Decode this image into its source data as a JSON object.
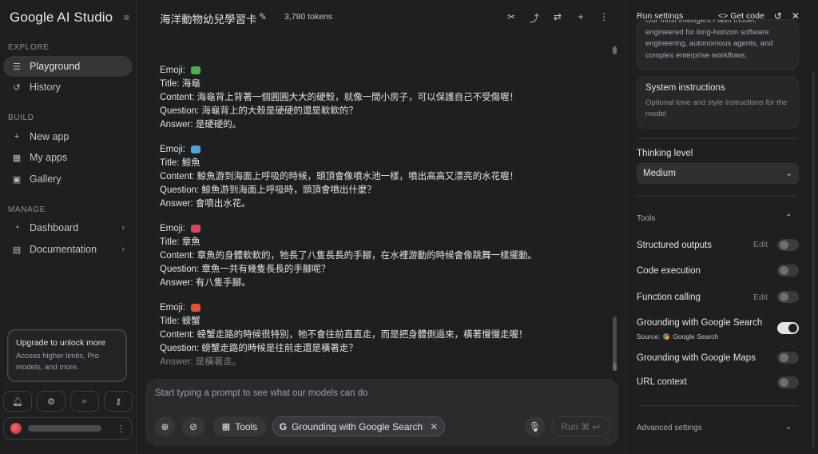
{
  "sidebar": {
    "logo": "Google AI Studio",
    "collapse_icon": "sidebar-collapse-icon",
    "explore_label": "EXPLORE",
    "playground": "Playground",
    "history": "History",
    "build_label": "BUILD",
    "new_app": "New app",
    "my_apps": "My apps",
    "gallery": "Gallery",
    "manage_label": "MANAGE",
    "dashboard": "Dashboard",
    "documentation": "Documentation",
    "upgrade_title": "Upgrade to unlock more",
    "upgrade_desc": "Access higher limits, Pro models, and more."
  },
  "topbar": {
    "title": "海洋動物幼兒學習卡",
    "tokens": "3,780 tokens"
  },
  "chat": {
    "cards": [
      {
        "emoji": "Emoji: ",
        "title": "Title: 海龜",
        "content": "Content: 海龜背上背著一個圓圓大大的硬殼，就像一間小房子，可以保護自己不受傷喔！",
        "question": "Question: 海龜背上的大殼是硬硬的還是軟軟的？",
        "answer": "Answer: 是硬硬的。"
      },
      {
        "emoji": "Emoji: ",
        "title": "Title: 鯨魚",
        "content": "Content: 鯨魚游到海面上呼吸的時候，頭頂會像噴水池一樣，噴出高高又漂亮的水花喔！",
        "question": "Question: 鯨魚游到海面上呼吸時，頭頂會噴出什麼？",
        "answer": "Answer: 會噴出水花。"
      },
      {
        "emoji": "Emoji: ",
        "title": "Title: 章魚",
        "content": "Content: 章魚的身體軟軟的，牠長了八隻長長的手腳，在水裡游動的時候會像跳舞一樣擺動。",
        "question": "Question: 章魚一共有幾隻長長的手腳呢？",
        "answer": "Answer: 有八隻手腳。"
      },
      {
        "emoji": "Emoji: ",
        "title": "Title: 螃蟹",
        "content": "Content: 螃蟹走路的時候很特別，牠不會往前直直走，而是把身體側過來，橫著慢慢走喔！",
        "question": "Question: 螃蟹走路的時候是往前走還是橫著走？",
        "answer": "Answer: 是橫著走。"
      }
    ]
  },
  "composer": {
    "placeholder": "Start typing a prompt to see what our models can do",
    "tools_label": "Tools",
    "grounding_chip": "Grounding with Google Search",
    "run_label": "Run ⌘ ↩"
  },
  "run_settings": {
    "title": "Run settings",
    "get_code": "Get code",
    "model_desc": "Our most intelligent Flash model, engineered for long-horizon software engineering, autonomous agents, and complex enterprise workflows.",
    "sys_title": "System instructions",
    "sys_placeholder": "Optional tone and style instructions for the model",
    "thinking_label": "Thinking level",
    "thinking_value": "Medium",
    "tools_label": "Tools",
    "structured_outputs": "Structured outputs",
    "code_execution": "Code execution",
    "function_calling": "Function calling",
    "grounding_search": "Grounding with Google Search",
    "source_label": "Source:",
    "source_value": "Google Search",
    "grounding_maps": "Grounding with Google Maps",
    "url_context": "URL context",
    "edit": "Edit",
    "advanced": "Advanced settings"
  },
  "colors": {
    "background": "#1e1f20",
    "panel": "#262729",
    "toggle_on": "#e3e3e3",
    "accent_chip_border": "#4b5670"
  }
}
